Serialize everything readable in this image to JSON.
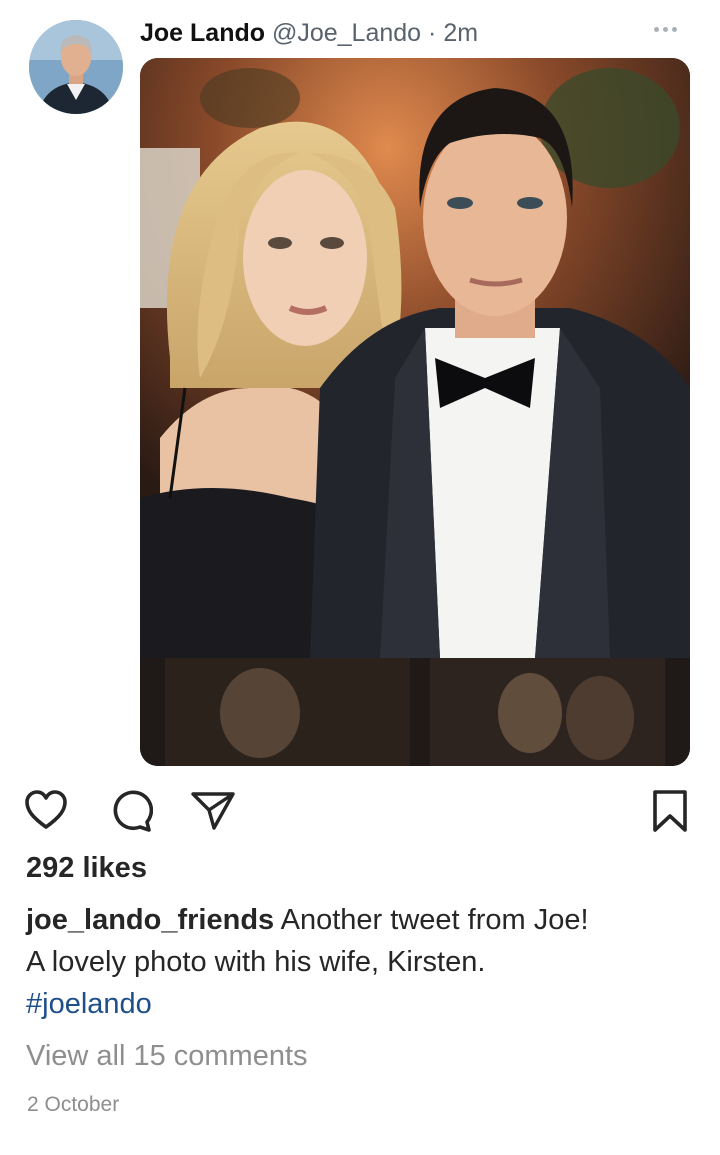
{
  "tweet": {
    "name": "Joe Lando",
    "handle": "@Joe_Lando",
    "separator": "·",
    "time": "2m"
  },
  "post": {
    "likes": "292 likes",
    "username": "joe_lando_friends",
    "caption_line1": "Another tweet from Joe!",
    "caption_line2": "A lovely photo with his wife, Kirsten.",
    "hashtag": "#joelando",
    "view_comments": "View all 15 comments",
    "date": "2 October"
  },
  "icons": {
    "like": "heart-icon",
    "comment": "comment-bubble-icon",
    "share": "send-icon",
    "save": "bookmark-icon",
    "more": "more-dots-icon"
  },
  "colors": {
    "text": "#262626",
    "muted": "#8e8e8e",
    "hashtag": "#1f4f8a",
    "handle": "#58636e"
  }
}
